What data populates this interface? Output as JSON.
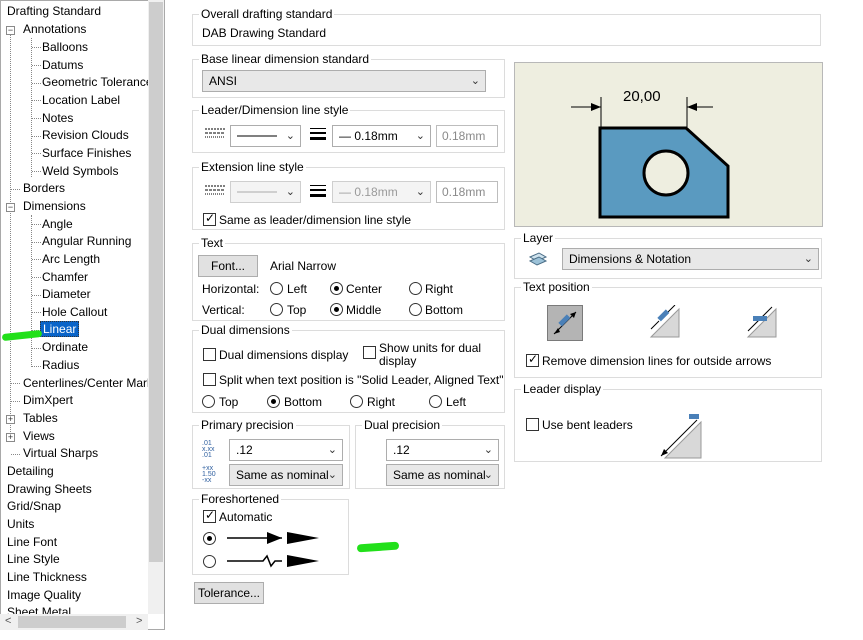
{
  "tree": {
    "items": [
      {
        "label": "Drafting Standard"
      },
      {
        "label": "Annotations"
      },
      {
        "label": "Balloons"
      },
      {
        "label": "Datums"
      },
      {
        "label": "Geometric Tolerance"
      },
      {
        "label": "Location Label"
      },
      {
        "label": "Notes"
      },
      {
        "label": "Revision Clouds"
      },
      {
        "label": "Surface Finishes"
      },
      {
        "label": "Weld Symbols"
      },
      {
        "label": "Borders"
      },
      {
        "label": "Dimensions"
      },
      {
        "label": "Angle"
      },
      {
        "label": "Angular Running"
      },
      {
        "label": "Arc Length"
      },
      {
        "label": "Chamfer"
      },
      {
        "label": "Diameter"
      },
      {
        "label": "Hole Callout"
      },
      {
        "label": "Linear"
      },
      {
        "label": "Ordinate"
      },
      {
        "label": "Radius"
      },
      {
        "label": "Centerlines/Center Marl"
      },
      {
        "label": "DimXpert"
      },
      {
        "label": "Tables"
      },
      {
        "label": "Views"
      },
      {
        "label": "Virtual Sharps"
      },
      {
        "label": "Detailing"
      },
      {
        "label": "Drawing Sheets"
      },
      {
        "label": "Grid/Snap"
      },
      {
        "label": "Units"
      },
      {
        "label": "Line Font"
      },
      {
        "label": "Line Style"
      },
      {
        "label": "Line Thickness"
      },
      {
        "label": "Image Quality"
      },
      {
        "label": "Sheet Metal"
      }
    ],
    "selected": "Linear",
    "expander_expanded": "−",
    "expander_collapsed": "+",
    "scroll_left": "<",
    "scroll_right": ">"
  },
  "overall": {
    "title": "Overall drafting standard",
    "value": "DAB Drawing Standard"
  },
  "base_linear": {
    "title": "Base linear dimension standard",
    "value": "ANSI"
  },
  "leader_style": {
    "title": "Leader/Dimension line style",
    "thickness": "0.18mm",
    "custom": "0.18mm"
  },
  "extension_style": {
    "title": "Extension line style",
    "thickness": "0.18mm",
    "custom": "0.18mm",
    "same_label": "Same as leader/dimension line style",
    "same_checked": true
  },
  "text": {
    "title": "Text",
    "font_button": "Font...",
    "font_name": "Arial Narrow",
    "horizontal_label": "Horizontal:",
    "h_left": "Left",
    "h_center": "Center",
    "h_right": "Right",
    "vertical_label": "Vertical:",
    "v_top": "Top",
    "v_middle": "Middle",
    "v_bottom": "Bottom"
  },
  "dual": {
    "title": "Dual dimensions",
    "display_label": "Dual dimensions display",
    "show_units_label_1": "Show units for dual",
    "show_units_label_2": "display",
    "split_label": "Split when text position is \"Solid Leader, Aligned Text\"",
    "pos_top": "Top",
    "pos_bottom": "Bottom",
    "pos_right": "Right",
    "pos_left": "Left"
  },
  "primary_precision": {
    "title": "Primary precision",
    "value": ".12",
    "tolerance": "Same as nominal"
  },
  "dual_precision": {
    "title": "Dual precision",
    "value": ".12",
    "tolerance": "Same as nominal"
  },
  "foreshortened": {
    "title": "Foreshortened",
    "automatic_label": "Automatic"
  },
  "tolerance_button": "Tolerance...",
  "preview": {
    "dimension_text": "20,00",
    "fill_color": "#5a9ac0"
  },
  "layer": {
    "title": "Layer",
    "value": "Dimensions & Notation"
  },
  "text_position": {
    "title": "Text position",
    "remove_label": "Remove dimension lines for outside arrows"
  },
  "leader_display": {
    "title": "Leader display",
    "bent_label": "Use bent leaders"
  },
  "colors": {
    "selection": "#0a64c8",
    "annotation": "#22e01a"
  }
}
